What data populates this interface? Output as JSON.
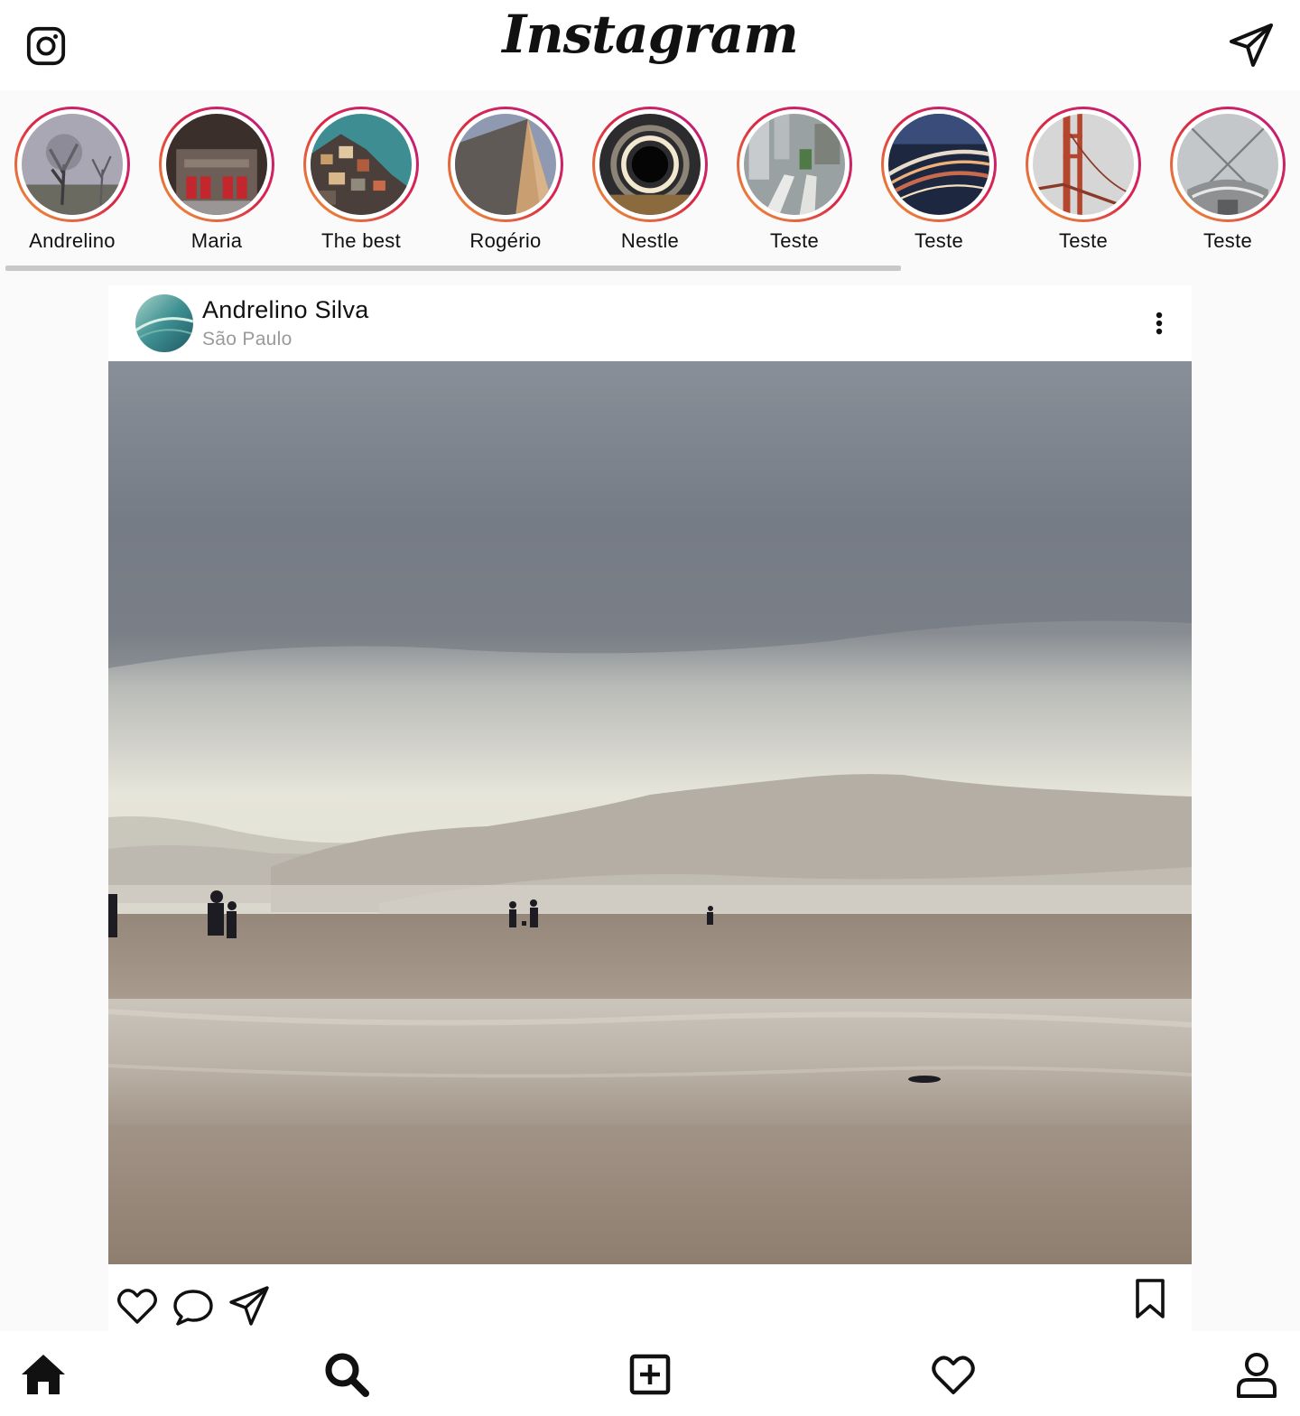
{
  "header": {
    "logo": "Instagram",
    "camera_icon": "instagram-camera-icon",
    "direct_icon": "paper-plane-icon"
  },
  "stories": [
    {
      "name": "Andrelino",
      "image": "foggy trees"
    },
    {
      "name": "Maria",
      "image": "building with red doors"
    },
    {
      "name": "The best",
      "image": "hillside houses"
    },
    {
      "name": "Rogério",
      "image": "sand dune"
    },
    {
      "name": "Nestle",
      "image": "light tunnel"
    },
    {
      "name": "Teste",
      "image": "skyscrapers from above"
    },
    {
      "name": "Teste",
      "image": "light trails"
    },
    {
      "name": "Teste",
      "image": "golden gate bridge"
    },
    {
      "name": "Teste",
      "image": "city view"
    }
  ],
  "post": {
    "username": "Andrelino Silva",
    "location": "São Paulo",
    "image": "beach with mountains under cloudy sky",
    "action_icons": [
      "heart-icon",
      "comment-icon",
      "share-icon",
      "bookmark-icon"
    ]
  },
  "bottom_nav": [
    "home-icon",
    "search-icon",
    "add-icon",
    "heart-icon",
    "profile-icon"
  ],
  "colors": {
    "story_ring_gradient": [
      "#f09433",
      "#e6683c",
      "#dc2743",
      "#cc2366",
      "#bc1888"
    ],
    "background": "#fafafa",
    "secondary_text": "#9a9a9a"
  }
}
